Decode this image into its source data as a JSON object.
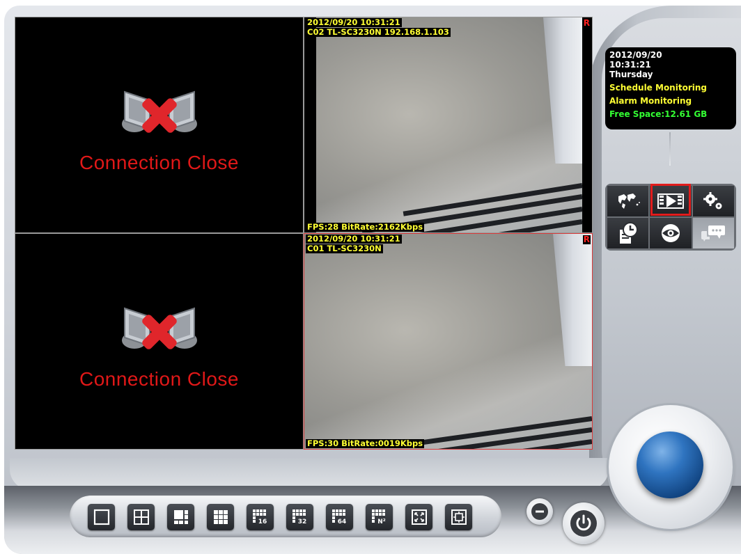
{
  "cameras": [
    {
      "state": "Connection Close"
    },
    {
      "datetime": "2012/09/20 10:31:21",
      "title": "C02 TL-SC3230N 192.168.1.103",
      "stats": "FPS:28 BitRate:2162Kbps",
      "rec": "R"
    },
    {
      "state": "Connection Close"
    },
    {
      "datetime": "2012/09/20 10:31:21",
      "title": "C01 TL-SC3230N",
      "stats": "FPS:30 BitRate:0019Kbps",
      "rec": "R"
    }
  ],
  "info": {
    "date": "2012/09/20",
    "time": "10:31:21",
    "day": "Thursday",
    "schedule": "Schedule Monitoring",
    "alarm": "Alarm Monitoring",
    "free_space": "Free Space:12.61 GB"
  },
  "toolbar": {
    "buttons": [
      {
        "icon": "world-map-icon",
        "selected": false
      },
      {
        "icon": "playback-icon",
        "selected": true
      },
      {
        "icon": "settings-gears-icon",
        "selected": false
      },
      {
        "icon": "schedule-log-icon",
        "selected": false
      },
      {
        "icon": "live-view-eye-icon",
        "selected": false
      },
      {
        "icon": "chat-message-icon",
        "selected": false,
        "disabled": true
      }
    ]
  },
  "layout_buttons": [
    {
      "icon": "layout-1-icon",
      "label": ""
    },
    {
      "icon": "layout-4-icon",
      "label": ""
    },
    {
      "icon": "layout-6-icon",
      "label": ""
    },
    {
      "icon": "layout-9-icon",
      "label": ""
    },
    {
      "icon": "layout-16-icon",
      "label": "16"
    },
    {
      "icon": "layout-32-icon",
      "label": "32"
    },
    {
      "icon": "layout-64-icon",
      "label": "64"
    },
    {
      "icon": "layout-n-icon",
      "label": "N²"
    },
    {
      "icon": "fullscreen-icon",
      "label": ""
    },
    {
      "icon": "sequence-icon",
      "label": ""
    }
  ],
  "colors": {
    "osd_text": "#ffff33",
    "closed_text": "#e01818",
    "highlight": "#e21c1c",
    "free_space": "#33ff33"
  }
}
